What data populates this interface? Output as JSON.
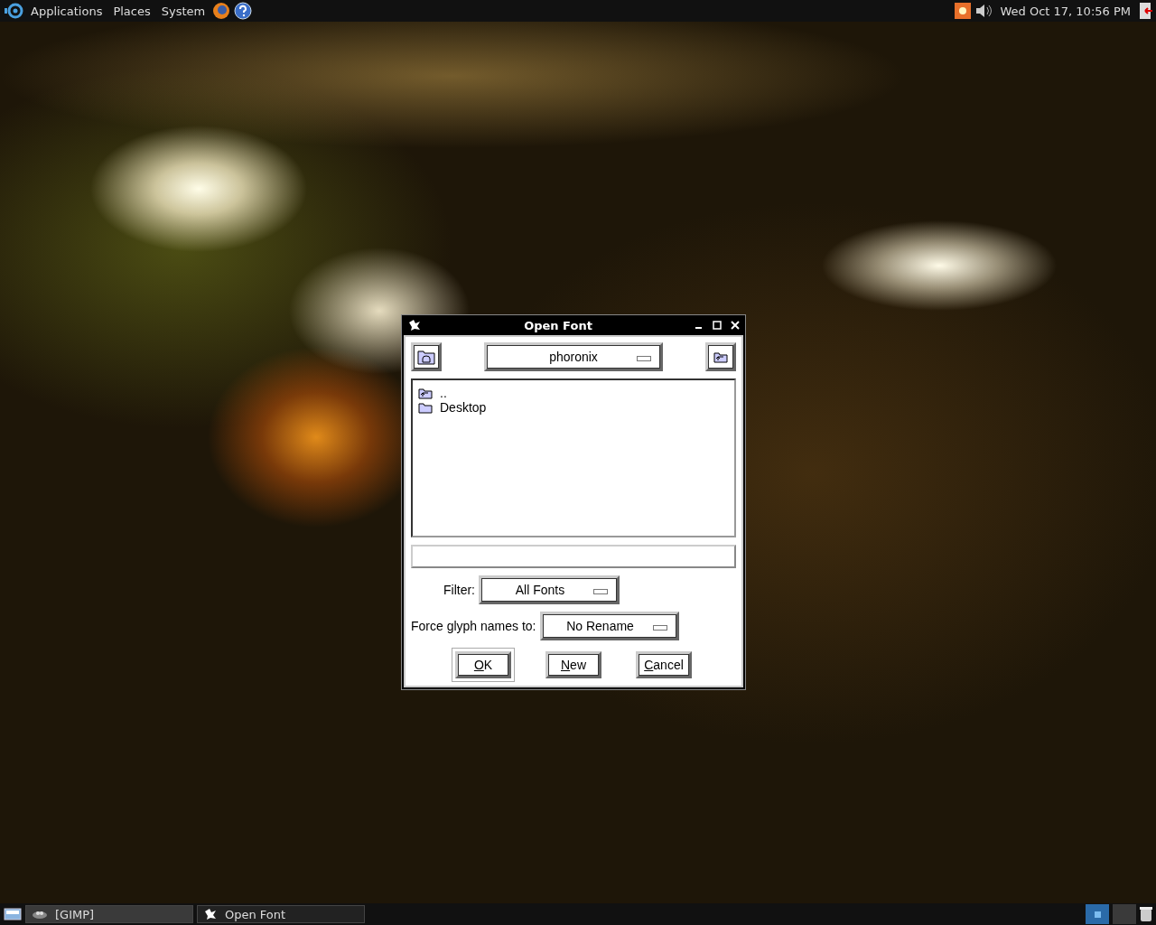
{
  "top_panel": {
    "menus": [
      "Applications",
      "Places",
      "System"
    ],
    "clock": "Wed Oct 17, 10:56 PM"
  },
  "dialog": {
    "title": "Open Font",
    "location": "phoronix",
    "files": [
      {
        "kind": "parent",
        "name": ".."
      },
      {
        "kind": "folder",
        "name": "Desktop"
      }
    ],
    "filter": {
      "label": "Filter:",
      "value": "All Fonts"
    },
    "rename": {
      "label": "Force glyph names to:",
      "value": "No Rename"
    },
    "buttons": [
      {
        "label": "OK",
        "default": true
      },
      {
        "label": "New",
        "default": false
      },
      {
        "label": "Cancel",
        "default": false
      }
    ]
  },
  "taskbar": {
    "windows": [
      {
        "label": "[GIMP]",
        "selected": false
      },
      {
        "label": "Open Font",
        "selected": true
      }
    ],
    "workspaces": [
      {
        "selected": true
      },
      {
        "selected": false
      }
    ]
  }
}
